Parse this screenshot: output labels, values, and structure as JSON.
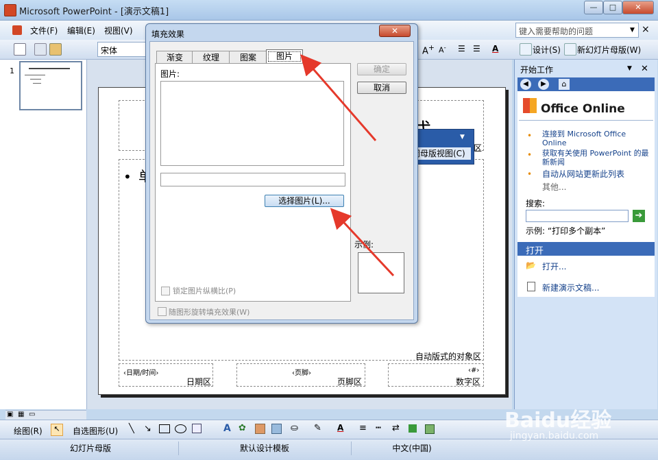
{
  "window": {
    "title": "Microsoft PowerPoint - [演示文稿1]",
    "min": "—",
    "max": "□",
    "close": "✕"
  },
  "menu": {
    "file": "文件(F)",
    "edit": "编辑(E)",
    "view": "视图(V)"
  },
  "help": {
    "placeholder": "键入需要帮助的问题",
    "close": "×"
  },
  "toolbar": {
    "font": "宋体",
    "design": "设计(S)",
    "new_master": "新幻灯片母版(W)"
  },
  "thumbs": {
    "number": "1"
  },
  "slide": {
    "title_fragment": "式",
    "bullet_fragment": "单",
    "object_area": "自动版式的对象区",
    "date_ph": "‹日期/时间›",
    "date_area": "日期区",
    "footer_ph": "‹页脚›",
    "footer_area": "页脚区",
    "number_ph": "‹#›",
    "number_area": "数字区",
    "master_toolbar_btn": "闭母版视图(C)",
    "master_edge": "区"
  },
  "taskpane": {
    "title": "开始工作",
    "office_online": "Office Online",
    "links": [
      "连接到 Microsoft Office Online",
      "获取有关使用 PowerPoint 的最新新闻",
      "自动从网站更新此列表"
    ],
    "more": "其他...",
    "search_label": "搜索:",
    "example": "示例: “打印多个副本”",
    "open_section": "打开",
    "open_link": "打开...",
    "new_link": "新建演示文稿..."
  },
  "dialog": {
    "title": "填充效果",
    "tabs": [
      "渐变",
      "纹理",
      "图案",
      "图片"
    ],
    "active_tab": "图片",
    "picture_label": "图片:",
    "select_picture": "选择图片(L)...",
    "ok": "确定",
    "cancel": "取消",
    "sample_label": "示例:",
    "lock_ratio": "锁定图片纵横比(P)",
    "rotate_with_shape": "随图形旋转填充效果(W)"
  },
  "drawbar": {
    "draw": "绘图(R)",
    "autoshapes": "自选图形(U)"
  },
  "status": {
    "master": "幻灯片母版",
    "template": "默认设计模板",
    "language": "中文(中国)"
  },
  "watermark": {
    "brand": "Baidu经验",
    "url": "jingyan.baidu.com"
  },
  "colors": {
    "accent": "#e5392b",
    "titlebar": "#a9c6e8"
  }
}
